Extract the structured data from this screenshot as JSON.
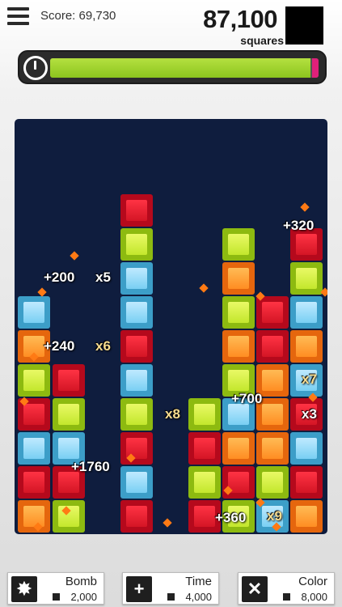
{
  "header": {
    "score_text": "Score: 69,730",
    "square_count": "87,100",
    "square_unit": "squares",
    "swatch_color": "#000000"
  },
  "timer": {
    "fill_fraction": 0.97
  },
  "board": {
    "popups": [
      {
        "text": "+320",
        "kind": "score"
      },
      {
        "text": "+200",
        "kind": "score"
      },
      {
        "text": "x5",
        "kind": "score"
      },
      {
        "text": "+240",
        "kind": "score"
      },
      {
        "text": "x6",
        "kind": "mult"
      },
      {
        "text": "x7",
        "kind": "mult"
      },
      {
        "text": "+700",
        "kind": "score"
      },
      {
        "text": "x8",
        "kind": "mult"
      },
      {
        "text": "x3",
        "kind": "score"
      },
      {
        "text": "+1760",
        "kind": "score"
      },
      {
        "text": "+360",
        "kind": "score"
      },
      {
        "text": "x9",
        "kind": "mult"
      }
    ],
    "columns": [
      [
        "orange",
        "red",
        "blue",
        "red",
        "lime",
        "orange",
        "blue"
      ],
      [
        "lime",
        "red",
        "blue",
        "lime",
        "red"
      ],
      [
        "red",
        "blue",
        "red",
        "lime",
        "blue",
        "red",
        "blue",
        "blue",
        "lime",
        "red"
      ],
      [
        "red",
        "lime",
        "red",
        "lime"
      ],
      [
        "lime",
        "red",
        "orange",
        "blue",
        "lime",
        "orange",
        "lime",
        "orange",
        "lime"
      ],
      [
        "blue",
        "lime",
        "orange",
        "orange",
        "orange",
        "red",
        "red"
      ],
      [
        "orange",
        "red",
        "blue",
        "red",
        "blue",
        "orange",
        "blue",
        "lime",
        "red"
      ]
    ],
    "block_colors": {
      "red": "#e41b2d",
      "blue": "#9fdcf7",
      "lime": "#cfe63a",
      "orange": "#ff9a2c"
    }
  },
  "powerups": [
    {
      "label": "Bomb",
      "cost": "2,000",
      "icon": "bomb-icon",
      "glyph": "✸"
    },
    {
      "label": "Time",
      "cost": "4,000",
      "icon": "plus-icon",
      "glyph": "+"
    },
    {
      "label": "Color",
      "cost": "8,000",
      "icon": "close-icon",
      "glyph": "✕"
    }
  ]
}
